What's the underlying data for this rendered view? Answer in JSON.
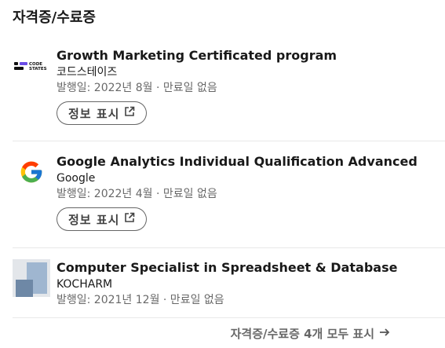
{
  "section": {
    "title": "자격증/수료증"
  },
  "certifications": [
    {
      "name": "Growth Marketing Certificated program",
      "issuer": "코드스테이즈",
      "date": "발행일: 2022년 8월 · 만료일 없음",
      "button": "정보 표시",
      "logo": "code-states-logo",
      "logo_text": "CODE STATES"
    },
    {
      "name": "Google Analytics Individual Qualification Advanced",
      "issuer": "Google",
      "date": "발행일: 2022년 4월 · 만료일 없음",
      "button": "정보 표시",
      "logo": "google-g-logo"
    },
    {
      "name": "Computer Specialist in Spreadsheet & Database",
      "issuer": "KOCHARM",
      "date": "발행일: 2021년 12월 · 만료일 없음",
      "logo": "placeholder-logo"
    }
  ],
  "footer": {
    "show_all": "자격증/수료증 4개 모두 표시",
    "arrow_icon": "arrow-right-icon"
  }
}
